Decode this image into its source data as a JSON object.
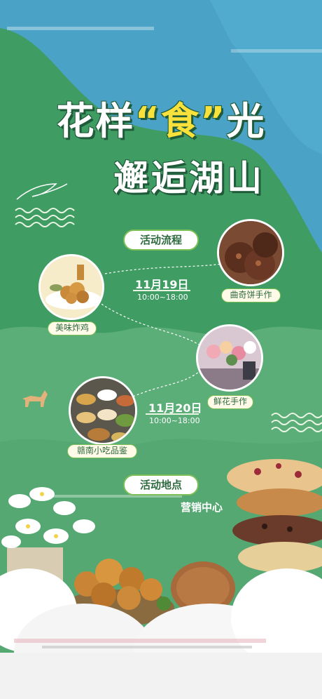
{
  "colors": {
    "sky_blue": "#4aa3c6",
    "main_green": "#3f9c62",
    "light_green": "#5cae78",
    "accent_yellow": "#f7e13a",
    "pill_border": "#7dbf57",
    "text_green": "#2f6b3f"
  },
  "title": {
    "line1_part1": "花样",
    "line1_quote_open": "“",
    "line1_highlight": "食",
    "line1_quote_close": "”",
    "line1_part2": "光",
    "line2": "邂逅湖山"
  },
  "schedule": {
    "heading": "活动流程",
    "day1": {
      "date": "11月19日",
      "time": "10:00~18:00"
    },
    "day2": {
      "date": "11月20日",
      "time": "10:00~18:00"
    },
    "activities": [
      {
        "label": "美味炸鸡",
        "icon": "fried-chicken-image"
      },
      {
        "label": "曲奇饼手作",
        "icon": "cookie-image"
      },
      {
        "label": "鲜花手作",
        "icon": "flower-shop-image"
      },
      {
        "label": "赣南小吃品鉴",
        "icon": "snack-buffet-image"
      }
    ]
  },
  "location": {
    "heading": "活动地点",
    "value": "营销中心"
  }
}
